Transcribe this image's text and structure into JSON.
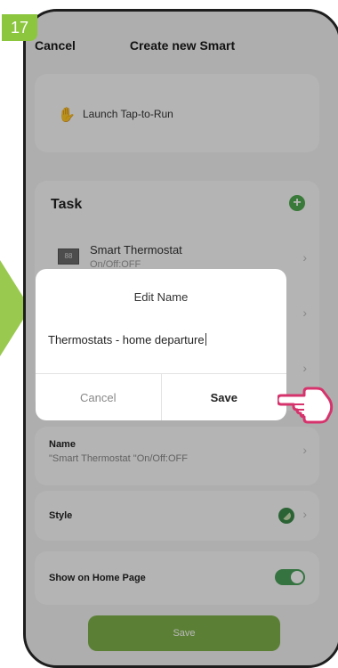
{
  "step": "17",
  "header": {
    "cancel_label": "Cancel",
    "title": "Create new Smart"
  },
  "launch": {
    "label": "Launch Tap-to-Run",
    "icon": "hand-tap-icon"
  },
  "task": {
    "title": "Task",
    "add_icon": "add-icon",
    "items": [
      {
        "title": "Smart Thermostat",
        "subtitle": "On/Off:OFF"
      }
    ]
  },
  "name_row": {
    "label": "Name",
    "value": "\"Smart Thermostat \"On/Off:OFF"
  },
  "style_row": {
    "label": "Style"
  },
  "home_row": {
    "label": "Show on Home Page",
    "toggle_on": true
  },
  "bottom_button": {
    "label": "Save"
  },
  "dialog": {
    "title": "Edit Name",
    "input_value": "Thermostats - home departure",
    "cancel_label": "Cancel",
    "save_label": "Save"
  },
  "colors": {
    "accent_green": "#8cc63f",
    "toggle_green": "#4aa05a",
    "save_button": "#7fb24a"
  }
}
